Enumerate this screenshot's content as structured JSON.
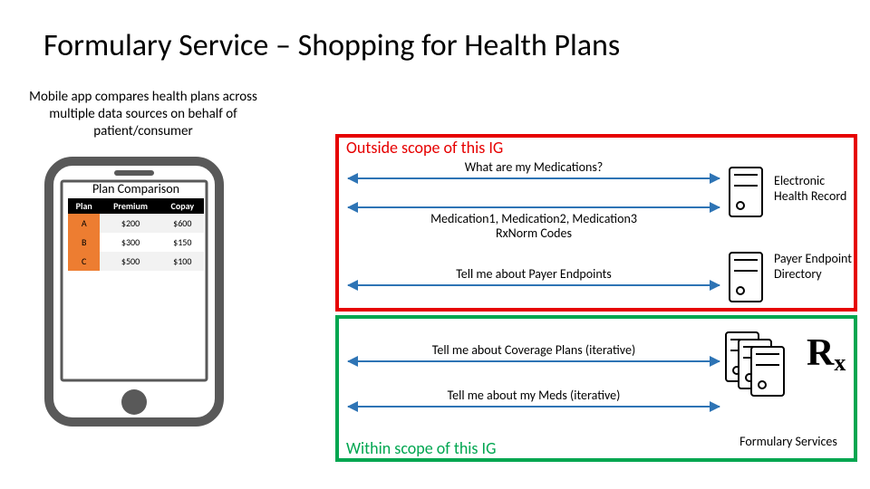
{
  "title": "Formulary Service – Shopping for Health Plans",
  "caption": "Mobile app compares health plans across multiple data sources on behalf of patient/consumer",
  "phone": {
    "screen_title": "Plan Comparison",
    "table": {
      "headers": [
        "Plan",
        "Premium",
        "Copay"
      ],
      "rows": [
        {
          "plan": "A",
          "premium": "$200",
          "copay": "$600"
        },
        {
          "plan": "B",
          "premium": "$300",
          "copay": "$150"
        },
        {
          "plan": "C",
          "premium": "$500",
          "copay": "$100"
        }
      ]
    }
  },
  "scope": {
    "outside_label": "Outside scope of this IG",
    "within_label": "Within scope of this IG"
  },
  "flows": {
    "q_meds": "What are my Medications?",
    "a_meds_line1": "Medication1, Medication2, Medication3",
    "a_meds_line2": "RxNorm Codes",
    "q_payer": "Tell me about Payer Endpoints",
    "q_cov": "Tell me about Coverage Plans (iterative)",
    "q_my_meds": "Tell me about my Meds (iterative)"
  },
  "actors": {
    "ehr": "Electronic Health Record",
    "payer": "Payer Endpoint Directory",
    "formulary": "Formulary Services"
  },
  "rx_symbol": "℞"
}
